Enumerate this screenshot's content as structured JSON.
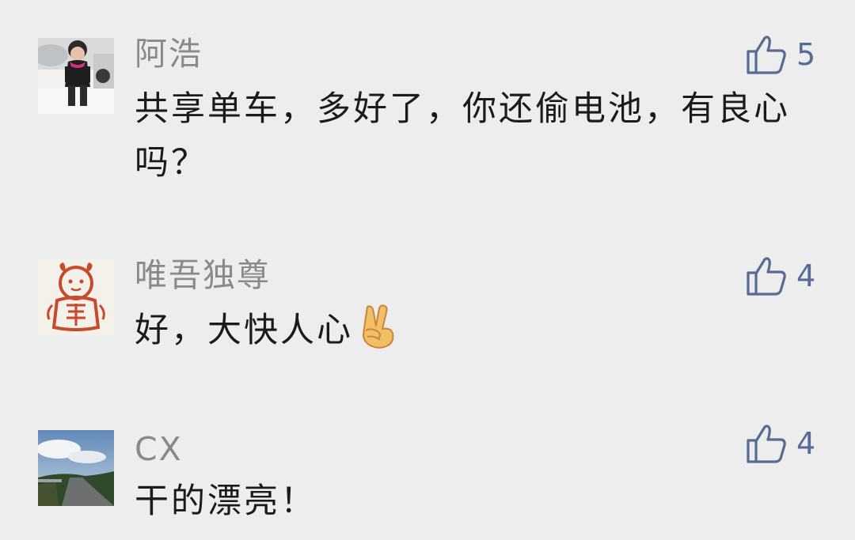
{
  "comments": [
    {
      "nickname": "阿浩",
      "text": "共享单车，多好了，你还偷电池，有良心吗？",
      "likes": "5",
      "avatar_icon": "child-photo-avatar"
    },
    {
      "nickname": "唯吾独尊",
      "text": "好，大快人心",
      "emoji_icon": "victory-hand-emoji",
      "likes": "4",
      "avatar_icon": "papercut-doll-avatar"
    },
    {
      "nickname": "CX",
      "text": "干的漂亮！",
      "likes": "4",
      "avatar_icon": "road-landscape-avatar"
    }
  ],
  "like_icon": "thumbs-up-icon",
  "colors": {
    "background": "#ededed",
    "nickname": "#8a8a8a",
    "text": "#1b1b1b",
    "like": "#576b95"
  }
}
